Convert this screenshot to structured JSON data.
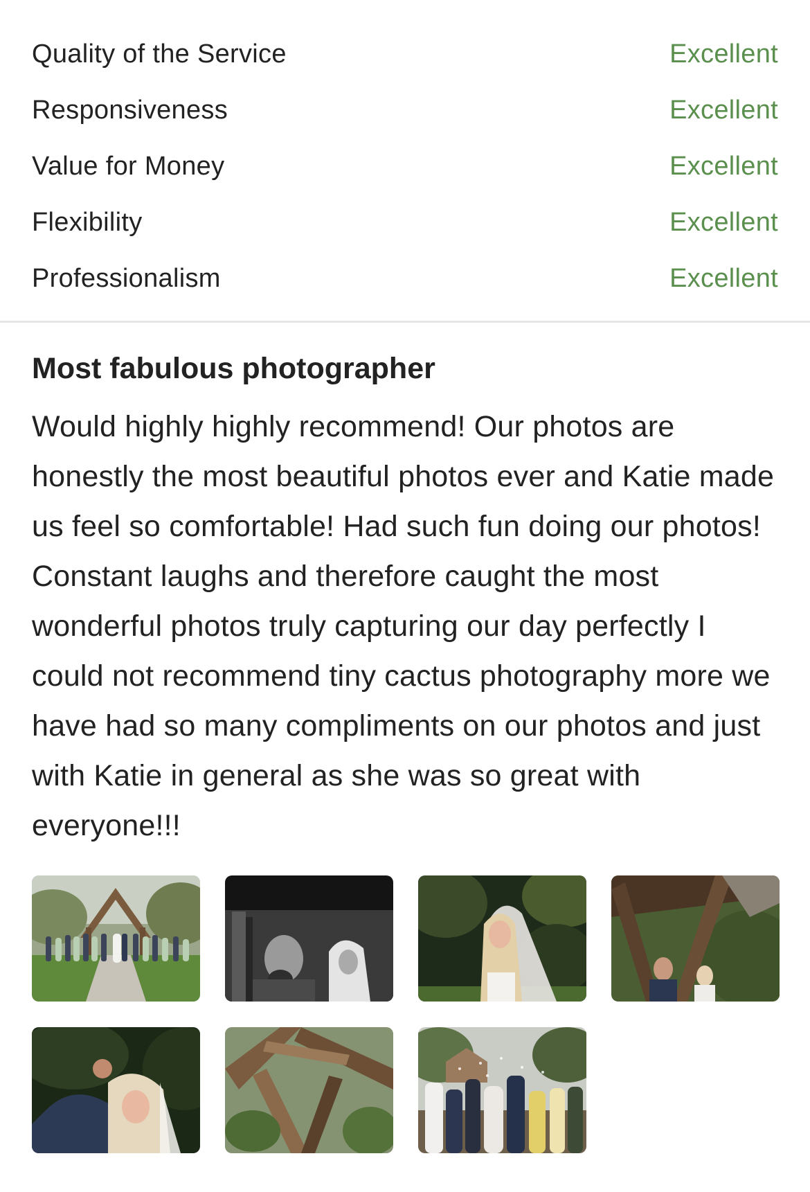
{
  "ratings": [
    {
      "label": "Quality of the Service",
      "value": "Excellent"
    },
    {
      "label": "Responsiveness",
      "value": "Excellent"
    },
    {
      "label": "Value for Money",
      "value": "Excellent"
    },
    {
      "label": "Flexibility",
      "value": "Excellent"
    },
    {
      "label": "Professionalism",
      "value": "Excellent"
    }
  ],
  "review": {
    "title": "Most fabulous photographer",
    "body": "Would highly highly recommend! Our photos are honestly the most beautiful photos ever and Katie made us feel so comfortable! Had such fun doing our photos! Constant laughs and therefore caught the most wonderful photos truly capturing our day perfectly I could not recommend tiny cactus photography more we have had so many compliments on our photos and just with Katie in general as she was so great with everyone!!!"
  },
  "colors": {
    "rating_value": "#5a8f4e",
    "text": "#222222",
    "divider": "#e6e6e6"
  },
  "photos": [
    {
      "name": "wedding-party-photo"
    },
    {
      "name": "black-and-white-couple-photo"
    },
    {
      "name": "bride-portrait-photo"
    },
    {
      "name": "couple-under-arch-photo"
    },
    {
      "name": "embrace-photo"
    },
    {
      "name": "wooden-arch-photo"
    },
    {
      "name": "confetti-exit-photo"
    }
  ]
}
